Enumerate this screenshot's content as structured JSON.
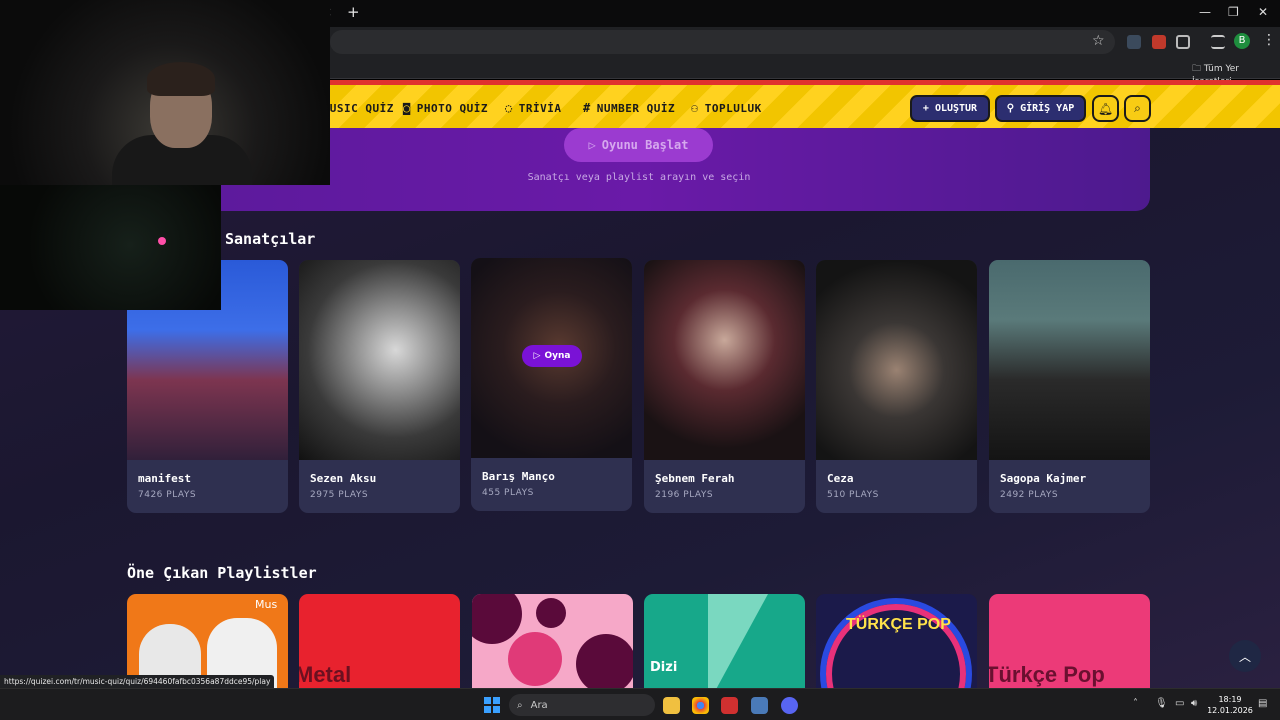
{
  "browser": {
    "tab_close_icon": "×",
    "new_tab_icon": "+",
    "window_controls": [
      "—",
      "❐",
      "✕"
    ],
    "bookmarks_folder_label": "Tüm Yer İşaretleri",
    "status_url": "https://quizei.com/tr/music-quiz/quiz/694460fafbc0356a87ddce95/play",
    "profile_initial": "B"
  },
  "site_nav": {
    "links": [
      {
        "label": "USIC QUİZ",
        "icon": "music-icon"
      },
      {
        "label": "PHOTO QUİZ",
        "icon": "camera-icon"
      },
      {
        "label": "TRİVİA",
        "icon": "chat-question-icon"
      },
      {
        "label": "NUMBER QUİZ",
        "icon": "hash-icon"
      },
      {
        "label": "TOPLULUK",
        "icon": "users-icon"
      }
    ],
    "create_label": "OLUŞTUR",
    "login_label": "GİRİŞ YAP"
  },
  "hero": {
    "start_button": "Oyunu Başlat",
    "subtitle": "Sanatçı veya playlist arayın ve seçin"
  },
  "artists_section": {
    "title": "Sanatçılar",
    "play_label": "Oyna",
    "items": [
      {
        "name": "manifest",
        "plays": "7426 PLAYS"
      },
      {
        "name": "Sezen Aksu",
        "plays": "2975 PLAYS"
      },
      {
        "name": "Barış Manço",
        "plays": "455 PLAYS"
      },
      {
        "name": "Şebnem Ferah",
        "plays": "2196 PLAYS"
      },
      {
        "name": "Ceza",
        "plays": "510 PLAYS"
      },
      {
        "name": "Sagopa Kajmer",
        "plays": "2492 PLAYS"
      }
    ]
  },
  "playlists_section": {
    "title": "Öne Çıkan Playlistler",
    "cards": [
      {
        "text": "Mus",
        "color": "#f07818"
      },
      {
        "text": "Metal",
        "color": "#e8222e"
      },
      {
        "text": "",
        "color": "#f6a8c8"
      },
      {
        "text": "Dizi",
        "color": "#17a88a"
      },
      {
        "text": "TÜRKÇE POP",
        "color": "#1b1a4a"
      },
      {
        "text": "Türkçe Pop",
        "color": "#ec3a78"
      }
    ]
  },
  "taskbar": {
    "search_placeholder": "Ara",
    "time": "18:19",
    "date": "12.01.2026"
  }
}
